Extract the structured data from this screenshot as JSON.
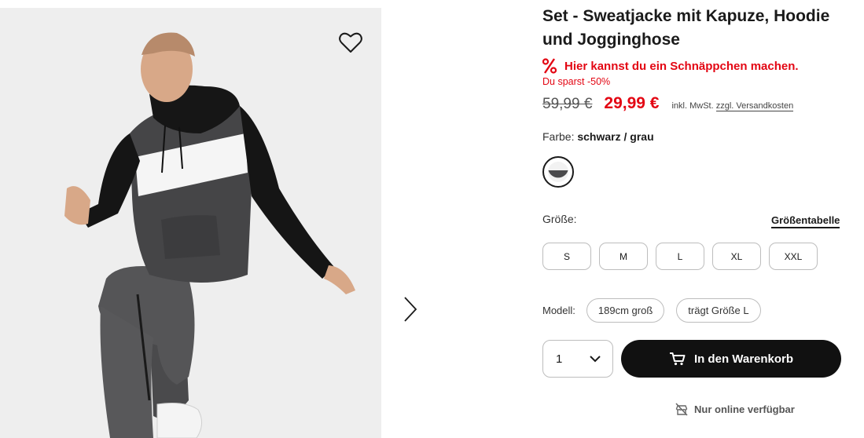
{
  "product": {
    "title": "Set - Sweatjacke mit Kapuze, Hoodie und Jogginghose",
    "deal_text": "Hier kannst du ein Schnäppchen machen.",
    "savings_text": "Du sparst -50%",
    "old_price": "59,99 €",
    "new_price": "29,99 €",
    "tax_text": "inkl. MwSt.",
    "shipping_link": "zzgl. Versandkosten"
  },
  "color": {
    "label": "Farbe:",
    "value": "schwarz / grau"
  },
  "sizes": {
    "label": "Größe:",
    "chart_link": "Größentabelle",
    "options": [
      "S",
      "M",
      "L",
      "XL",
      "XXL"
    ]
  },
  "model": {
    "label": "Modell:",
    "height": "189cm groß",
    "size_worn": "trägt Größe L"
  },
  "cart": {
    "quantity": "1",
    "button_label": "In den Warenkorb"
  },
  "availability": {
    "text": "Nur online verfügbar"
  },
  "colors": {
    "sale_red": "#e30613",
    "button_black": "#111111"
  },
  "icons": {
    "wishlist": "heart-outline-icon",
    "next": "chevron-right-icon",
    "deal": "percent-icon",
    "cart": "cart-icon",
    "online": "store-crossed-icon",
    "dropdown": "chevron-down-icon"
  }
}
